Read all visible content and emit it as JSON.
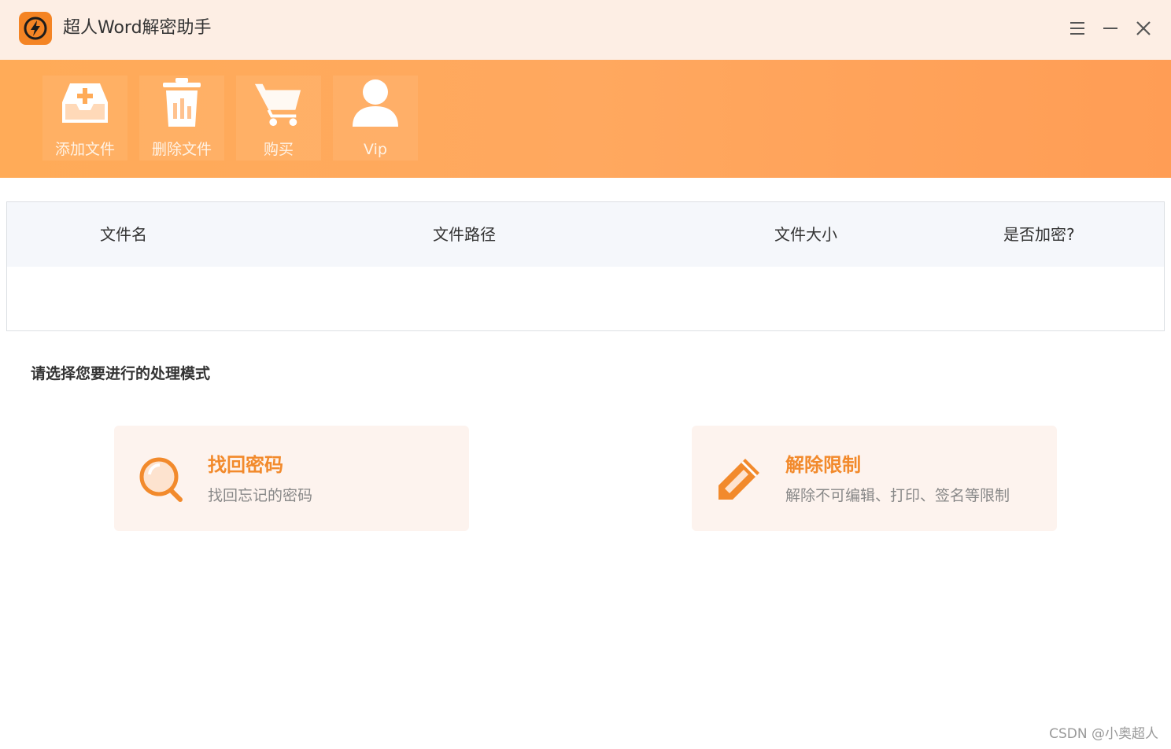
{
  "app": {
    "title": "超人Word解密助手"
  },
  "window_controls": {
    "menu_icon": "hamburger-menu-icon",
    "minimize_icon": "minimize-icon",
    "close_icon": "close-icon"
  },
  "toolbar": {
    "items": [
      {
        "label": "添加文件",
        "icon": "inbox-add-icon"
      },
      {
        "label": "删除文件",
        "icon": "trash-icon"
      },
      {
        "label": "购买",
        "icon": "shopping-cart-icon"
      },
      {
        "label": "Vip",
        "icon": "user-icon"
      }
    ]
  },
  "table": {
    "columns": [
      "文件名",
      "文件路径",
      "文件大小",
      "是否加密?"
    ],
    "rows": []
  },
  "mode": {
    "prompt": "请选择您要进行的处理模式",
    "cards": [
      {
        "title": "找回密码",
        "description": "找回忘记的密码",
        "icon": "magnifier-icon"
      },
      {
        "title": "解除限制",
        "description": "解除不可编辑、打印、签名等限制",
        "icon": "pencil-icon"
      }
    ]
  },
  "watermark": "CSDN @小奥超人",
  "colors": {
    "accent": "#f28a2c",
    "toolbar_bg": "#ffa85f",
    "titlebar_bg": "#fdeee4",
    "card_bg": "#fdf3ee"
  }
}
